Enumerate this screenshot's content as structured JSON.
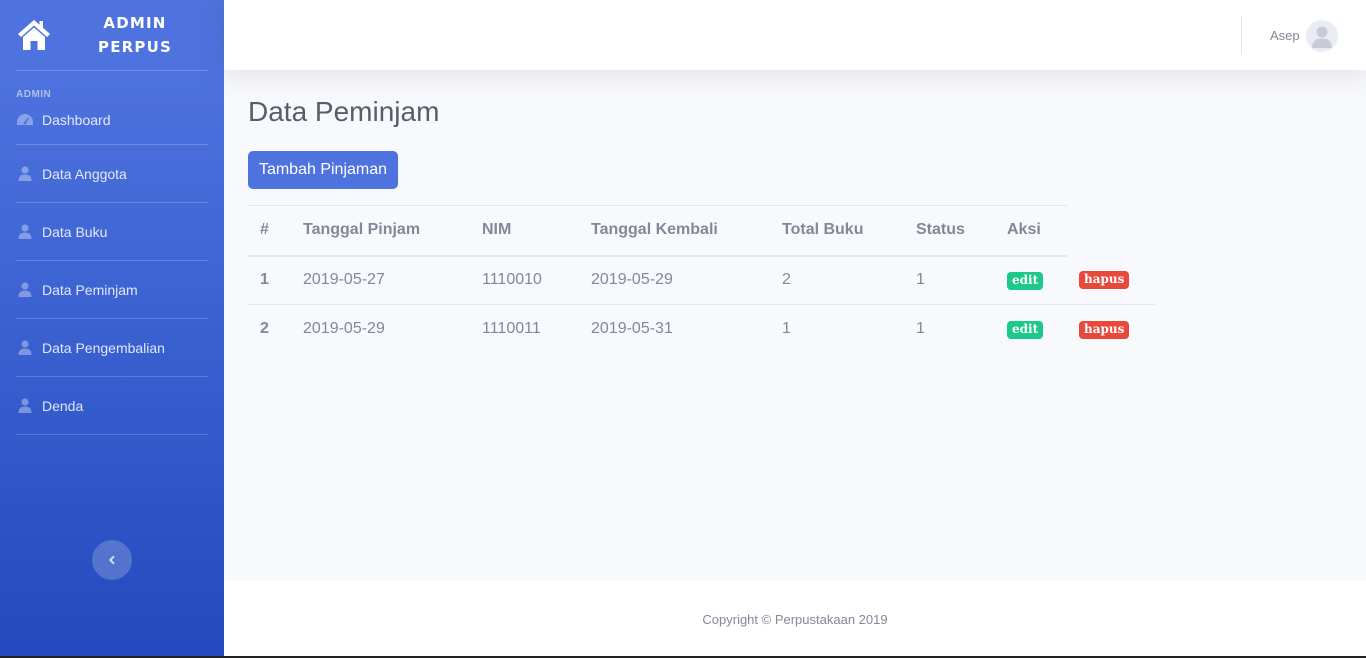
{
  "sidebar": {
    "brand_line1": "ADMIN",
    "brand_line2": "PERPUS",
    "heading": "ADMIN",
    "items": [
      {
        "label": "Dashboard",
        "icon": "tachometer-icon"
      },
      {
        "label": "Data Anggota",
        "icon": "user-icon"
      },
      {
        "label": "Data Buku",
        "icon": "user-icon"
      },
      {
        "label": "Data Peminjam",
        "icon": "user-icon"
      },
      {
        "label": "Data Pengembalian",
        "icon": "user-icon"
      },
      {
        "label": "Denda",
        "icon": "user-icon"
      }
    ],
    "toggle_icon": "chevron-left-icon"
  },
  "topbar": {
    "user_name": "Asep",
    "avatar_icon": "user-avatar-icon"
  },
  "main": {
    "title": "Data Peminjam",
    "add_button": "Tambah Pinjaman",
    "table": {
      "headers": [
        "#",
        "Tanggal Pinjam",
        "NIM",
        "Tanggal Kembali",
        "Total Buku",
        "Status",
        "Aksi"
      ],
      "rows": [
        {
          "num": "1",
          "tanggal_pinjam": "2019-05-27",
          "nim": "1110010",
          "tanggal_kembali": "2019-05-29",
          "total_buku": "2",
          "status": "1",
          "edit": "edit",
          "hapus": "hapus"
        },
        {
          "num": "2",
          "tanggal_pinjam": "2019-05-29",
          "nim": "1110011",
          "tanggal_kembali": "2019-05-31",
          "total_buku": "1",
          "status": "1",
          "edit": "edit",
          "hapus": "hapus"
        }
      ]
    }
  },
  "footer": {
    "copyright": "Copyright © Perpustakaan 2019"
  },
  "colors": {
    "primary": "#4e73df",
    "primary_dark": "#224abe",
    "success": "#1cc88a",
    "danger": "#e74a3b",
    "text": "#858796",
    "heading": "#5a5c69",
    "background": "#f8f9fc"
  }
}
